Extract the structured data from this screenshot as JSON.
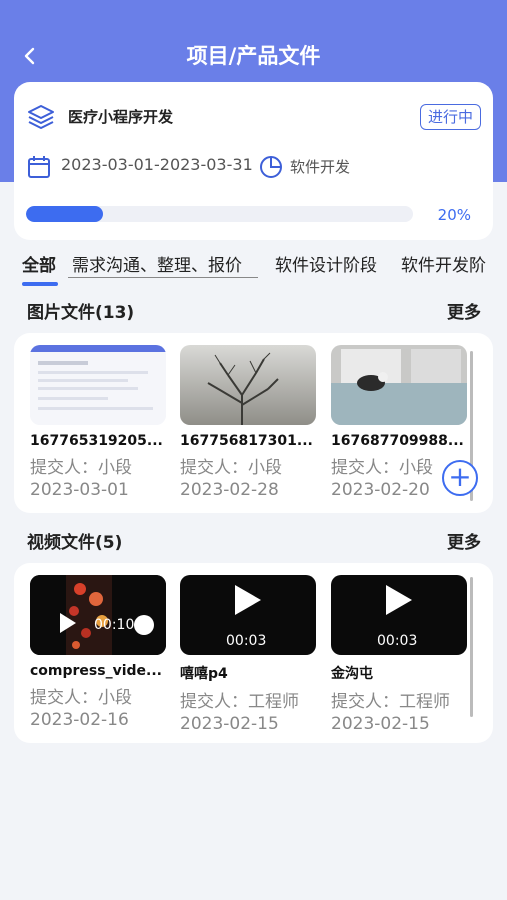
{
  "header": {
    "title": "项目/产品文件",
    "back_icon": "chevron-left-icon"
  },
  "project": {
    "name": "医疗小程序开发",
    "status": "进行中",
    "date_range": "2023-03-01-2023-03-31",
    "category": "软件开发",
    "progress": 0.2,
    "progress_text": "20%",
    "accent": "#3d6cf0"
  },
  "tabs": [
    "全部",
    "需求沟通、整理、报价",
    "软件设计阶段",
    "软件开发阶"
  ],
  "images": {
    "title": "图片文件(13)",
    "more": "更多",
    "items": [
      {
        "name": "167765319205...",
        "submitter": "提交人：小段",
        "date": "2023-03-01"
      },
      {
        "name": "167756817301...",
        "submitter": "提交人：小段",
        "date": "2023-02-28"
      },
      {
        "name": "167687709988...",
        "submitter": "提交人：小段",
        "date": "2023-02-20"
      }
    ]
  },
  "videos": {
    "title": "视频文件(5)",
    "more": "更多",
    "items": [
      {
        "name": "compress_vide...",
        "submitter": "提交人：小段",
        "date": "2023-02-16",
        "duration": "00:10"
      },
      {
        "name": "嘻嘻p4",
        "submitter": "提交人：工程师",
        "date": "2023-02-15",
        "duration": "00:03"
      },
      {
        "name": "金沟屯",
        "submitter": "提交人：工程师",
        "date": "2023-02-15",
        "duration": "00:03"
      }
    ]
  }
}
